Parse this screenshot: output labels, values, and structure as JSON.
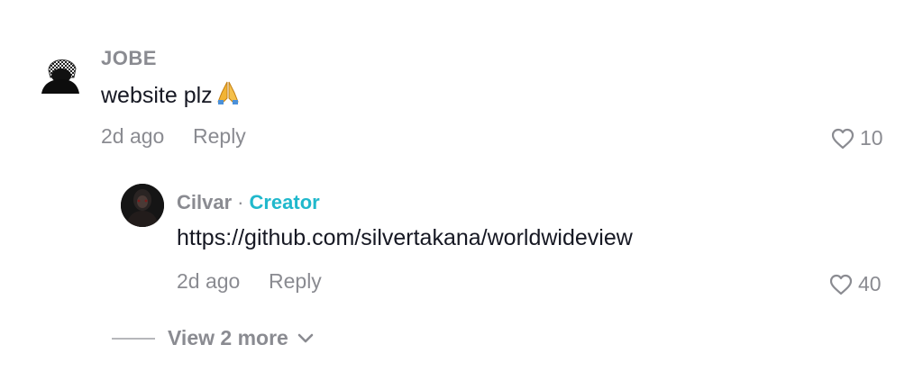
{
  "comment": {
    "username": "JOBE",
    "text": "website plz",
    "emoji": "folded-hands-emoji",
    "time": "2d ago",
    "reply_label": "Reply",
    "likes": "10"
  },
  "reply": {
    "username": "Cilvar",
    "separator": "·",
    "badge": "Creator",
    "badge_color": "#20b8cc",
    "text": "https://github.com/silvertakana/worldwideview",
    "time": "2d ago",
    "reply_label": "Reply",
    "likes": "40"
  },
  "view_more": {
    "label": "View 2 more",
    "icon": "chevron-down-icon"
  }
}
